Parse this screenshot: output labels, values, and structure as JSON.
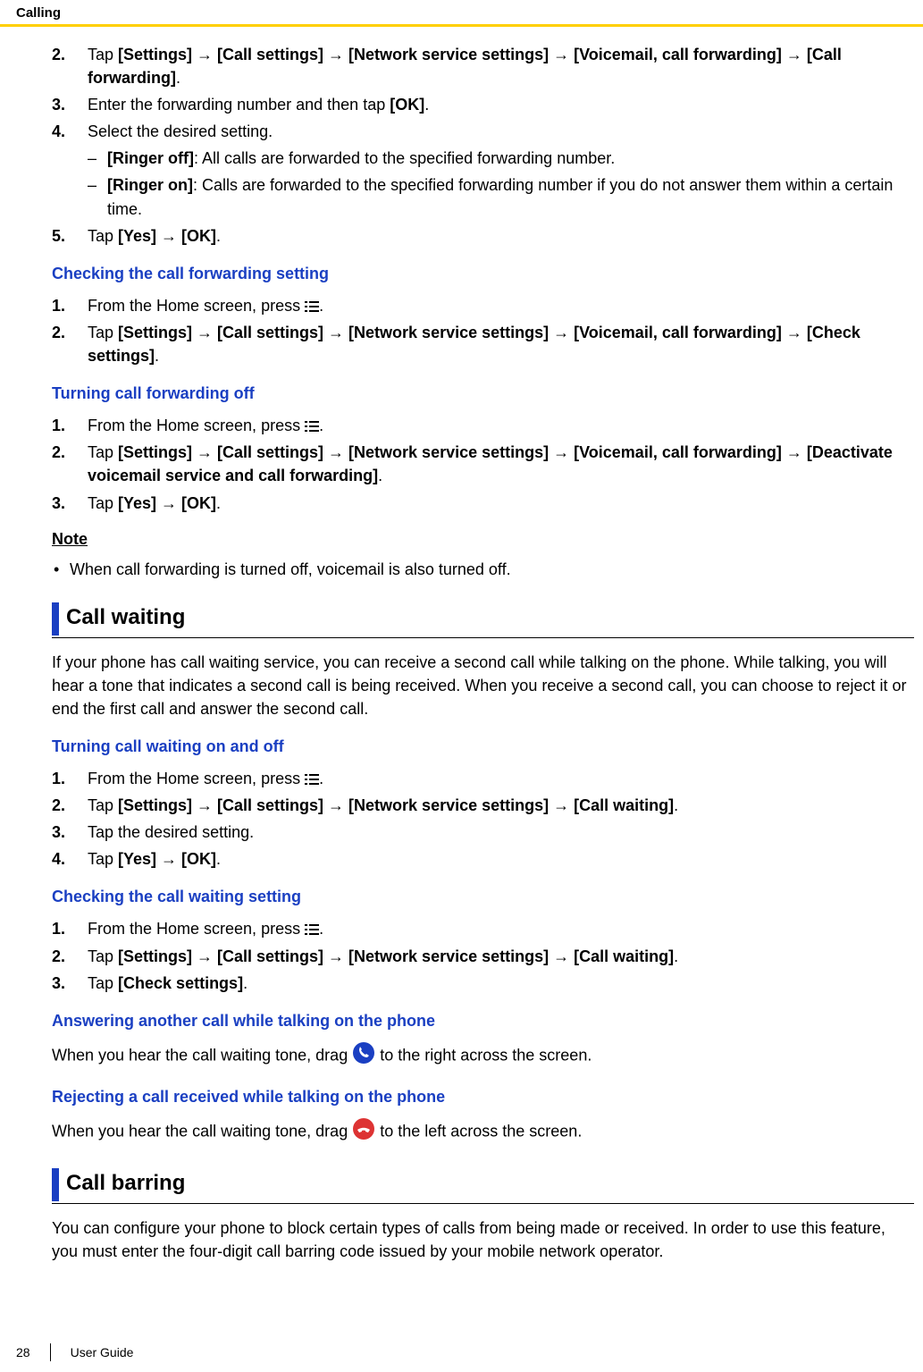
{
  "header": {
    "section": "Calling"
  },
  "steps_a": {
    "n2": "2.",
    "t2_pre": "Tap ",
    "t2_path": "[Settings] → [Call settings] → [Network service settings] → [Voicemail, call forwarding] → [Call forwarding]",
    "t2_post": ".",
    "n3": "3.",
    "t3_pre": "Enter the forwarding number and then tap ",
    "t3_b": "[OK]",
    "t3_post": ".",
    "n4": "4.",
    "t4": "Select the desired setting.",
    "t4a_b": "[Ringer off]",
    "t4a": ": All calls are forwarded to the specified forwarding number.",
    "t4b_b": "[Ringer on]",
    "t4b": ": Calls are forwarded to the specified forwarding number if you do not answer them within a certain time.",
    "n5": "5.",
    "t5_pre": "Tap ",
    "t5_b": "[Yes] → [OK]",
    "t5_post": "."
  },
  "sub1": {
    "title": "Checking the call forwarding setting"
  },
  "steps_b": {
    "n1": "1.",
    "t1_pre": "From the Home screen, press ",
    "t1_post": ".",
    "n2": "2.",
    "t2_pre": "Tap ",
    "t2_path": "[Settings] → [Call settings] → [Network service settings] → [Voicemail, call forwarding] → [Check settings]",
    "t2_post": "."
  },
  "sub2": {
    "title": "Turning call forwarding off"
  },
  "steps_c": {
    "n1": "1.",
    "t1_pre": "From the Home screen, press ",
    "t1_post": ".",
    "n2": "2.",
    "t2_pre": "Tap ",
    "t2_path": "[Settings] → [Call settings] → [Network service settings] → [Voicemail, call forwarding] → [Deactivate voicemail service and call forwarding]",
    "t2_post": ".",
    "n3": "3.",
    "t3_pre": "Tap ",
    "t3_b": "[Yes] → [OK]",
    "t3_post": "."
  },
  "note": {
    "heading": "Note",
    "bullet1": "When call forwarding is turned off, voicemail is also turned off."
  },
  "h2a": {
    "title": "Call waiting"
  },
  "para1": "If your phone has call waiting service, you can receive a second call while talking on the phone. While talking, you will hear a tone that indicates a second call is being received. When you receive a second call, you can choose to reject it or end the first call and answer the second call.",
  "sub3": {
    "title": "Turning call waiting on and off"
  },
  "steps_d": {
    "n1": "1.",
    "t1_pre": "From the Home screen, press ",
    "t1_post": ".",
    "n2": "2.",
    "t2_pre": "Tap ",
    "t2_path": "[Settings] → [Call settings] → [Network service settings] → [Call waiting]",
    "t2_post": ".",
    "n3": "3.",
    "t3": "Tap the desired setting.",
    "n4": "4.",
    "t4_pre": "Tap ",
    "t4_b": "[Yes] → [OK]",
    "t4_post": "."
  },
  "sub4": {
    "title": "Checking the call waiting setting"
  },
  "steps_e": {
    "n1": "1.",
    "t1_pre": "From the Home screen, press ",
    "t1_post": ".",
    "n2": "2.",
    "t2_pre": "Tap ",
    "t2_path": "[Settings] → [Call settings] → [Network service settings] → [Call waiting]",
    "t2_post": ".",
    "n3": "3.",
    "t3_pre": "Tap ",
    "t3_b": "[Check settings]",
    "t3_post": "."
  },
  "sub5": {
    "title": "Answering another call while talking on the phone"
  },
  "ans_pre": "When you hear the call waiting tone, drag ",
  "ans_post": " to the right across the screen.",
  "sub6": {
    "title": "Rejecting a call received while talking on the phone"
  },
  "rej_pre": "When you hear the call waiting tone, drag ",
  "rej_post": " to the left across the screen.",
  "h2b": {
    "title": "Call barring"
  },
  "para2": "You can configure your phone to block certain types of calls from being made or received. In order to use this feature, you must enter the four-digit call barring code issued by your mobile network operator.",
  "footer": {
    "page": "28",
    "guide": "User Guide"
  }
}
